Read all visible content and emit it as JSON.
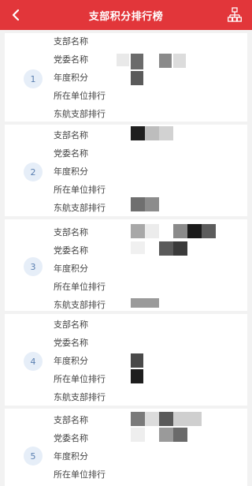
{
  "header": {
    "title": "支部积分排行榜",
    "back_icon": "back-arrow-icon",
    "right_icon": "org-chart-icon"
  },
  "colors": {
    "brand_red": "#e2363a",
    "badge_bg": "#e6eef8",
    "badge_text": "#5a7fb0"
  },
  "cards": [
    {
      "rank": "1",
      "labels": [
        "支部名称",
        "党委名称",
        "年度积分",
        "所在单位排行",
        "东航支部排行"
      ]
    },
    {
      "rank": "2",
      "labels": [
        "支部名称",
        "党委名称",
        "年度积分",
        "所在单位排行",
        "东航支部排行"
      ]
    },
    {
      "rank": "3",
      "labels": [
        "支部名称",
        "党委名称",
        "年度积分",
        "所在单位排行",
        "东航支部排行"
      ]
    },
    {
      "rank": "4",
      "labels": [
        "支部名称",
        "党委名称",
        "年度积分",
        "所在单位排行",
        "东航支部排行"
      ]
    },
    {
      "rank": "5",
      "labels": [
        "支部名称",
        "党委名称",
        "年度积分",
        "所在单位排行"
      ]
    }
  ]
}
